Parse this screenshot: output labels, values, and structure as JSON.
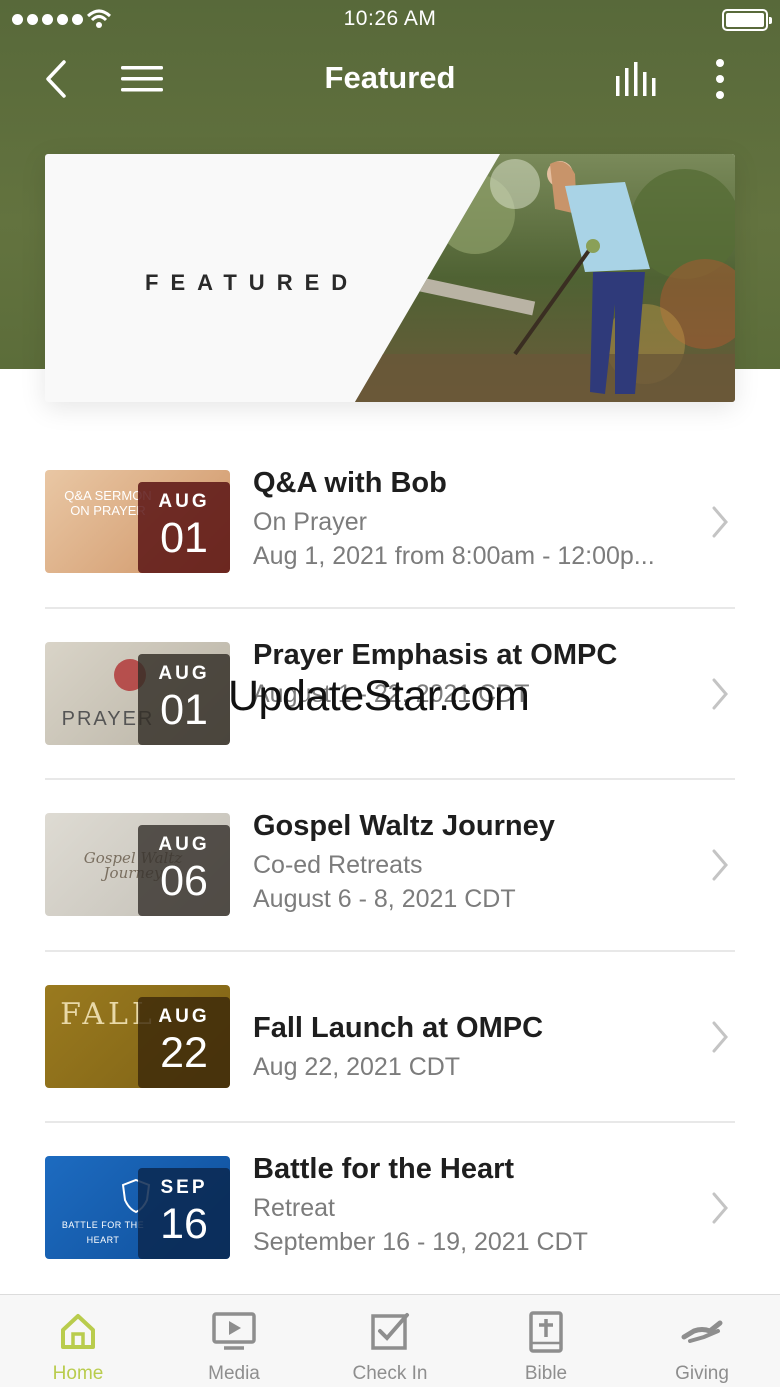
{
  "status_bar": {
    "time": "10:26 AM"
  },
  "nav": {
    "title": "Featured"
  },
  "banner": {
    "text": "FEATURED"
  },
  "colors": {
    "header_green": "#5c6d3a",
    "active_tab": "#b9cc4d",
    "text_dark": "#1e1e1e",
    "text_gray": "#7c7c7c"
  },
  "events": [
    {
      "month": "AUG",
      "day": "01",
      "title": "Q&A with Bob",
      "lines": [
        "On Prayer",
        "Aug 1, 2021 from 8:00am - 12:00p..."
      ],
      "thumb_text": "Q&A SERMON ON PRAYER"
    },
    {
      "month": "AUG",
      "day": "01",
      "title": "Prayer Emphasis at OMPC",
      "lines": [
        "August 1 - 22, 2021 CDT"
      ],
      "thumb_text": "PRAYER"
    },
    {
      "month": "AUG",
      "day": "06",
      "title": "Gospel Waltz Journey",
      "lines": [
        "Co-ed Retreats",
        "August 6 - 8, 2021 CDT"
      ],
      "thumb_text": "Gospel Waltz Journey"
    },
    {
      "month": "AUG",
      "day": "22",
      "title": "Fall Launch at OMPC",
      "lines": [
        "Aug 22, 2021 CDT"
      ],
      "thumb_text": "FALL"
    },
    {
      "month": "SEP",
      "day": "16",
      "title": "Battle for the Heart",
      "lines": [
        "Retreat",
        "September 16 - 19, 2021 CDT"
      ],
      "thumb_text": "BATTLE FOR THE HEART"
    }
  ],
  "watermark": "UpdateStar.com",
  "tabs": [
    {
      "label": "Home",
      "icon": "home-icon",
      "active": true
    },
    {
      "label": "Media",
      "icon": "media-icon",
      "active": false
    },
    {
      "label": "Check In",
      "icon": "checkin-icon",
      "active": false
    },
    {
      "label": "Bible",
      "icon": "bible-icon",
      "active": false
    },
    {
      "label": "Giving",
      "icon": "giving-icon",
      "active": false
    }
  ]
}
